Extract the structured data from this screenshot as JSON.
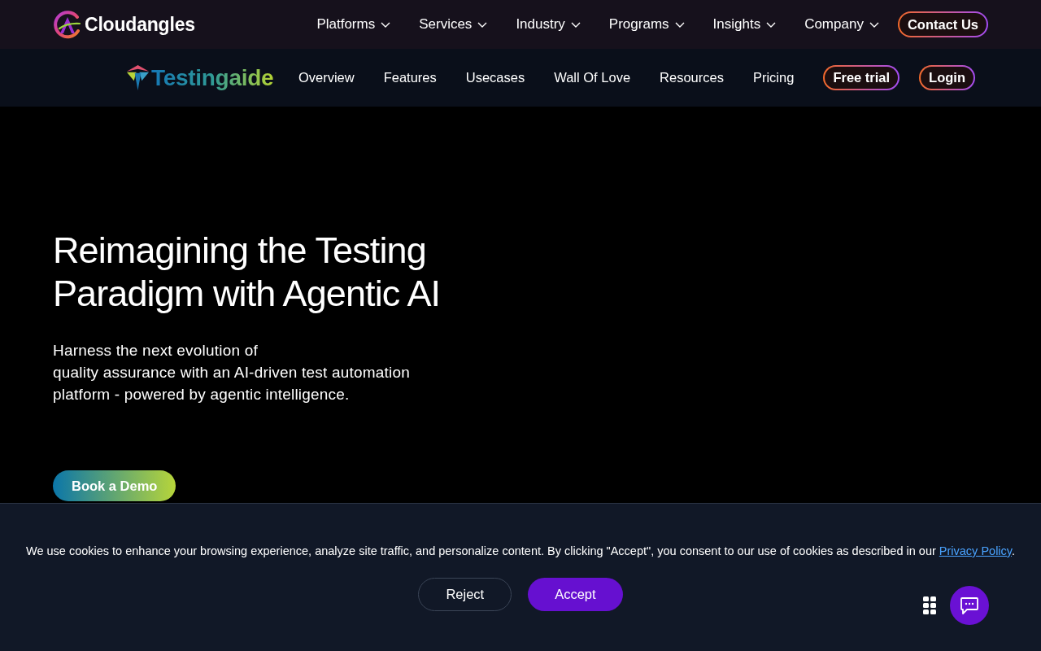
{
  "top_nav": {
    "brand": "Cloudangles",
    "items": [
      {
        "label": "Platforms",
        "has_dropdown": true
      },
      {
        "label": "Services",
        "has_dropdown": true
      },
      {
        "label": "Industry",
        "has_dropdown": true
      },
      {
        "label": "Programs",
        "has_dropdown": true
      },
      {
        "label": "Insights",
        "has_dropdown": true
      },
      {
        "label": "Company",
        "has_dropdown": true
      }
    ],
    "cta": "Contact Us"
  },
  "sub_nav": {
    "brand": "Testingaide",
    "items": [
      "Overview",
      "Features",
      "Usecases",
      "Wall Of Love",
      "Resources",
      "Pricing"
    ],
    "buttons": [
      "Free trial",
      "Login"
    ]
  },
  "hero": {
    "title_lines": [
      "Reimagining the Testing",
      "Paradigm with Agentic AI"
    ],
    "text_lines": [
      "Harness the next evolution of",
      "quality assurance with an AI-driven test automation platform - powered by agentic intelligence."
    ],
    "button": "Book a Demo"
  },
  "cookie_banner": {
    "text": "We use cookies to enhance your browsing experience, analyze site traffic, and personalize content. By clicking \"Accept\", you consent to our use of cookies as described in our ",
    "link": "Privacy Policy",
    "text_after_link": ".",
    "buttons": [
      {
        "label": "Reject",
        "kind": "secondary"
      },
      {
        "label": "Accept",
        "kind": "primary"
      }
    ]
  }
}
